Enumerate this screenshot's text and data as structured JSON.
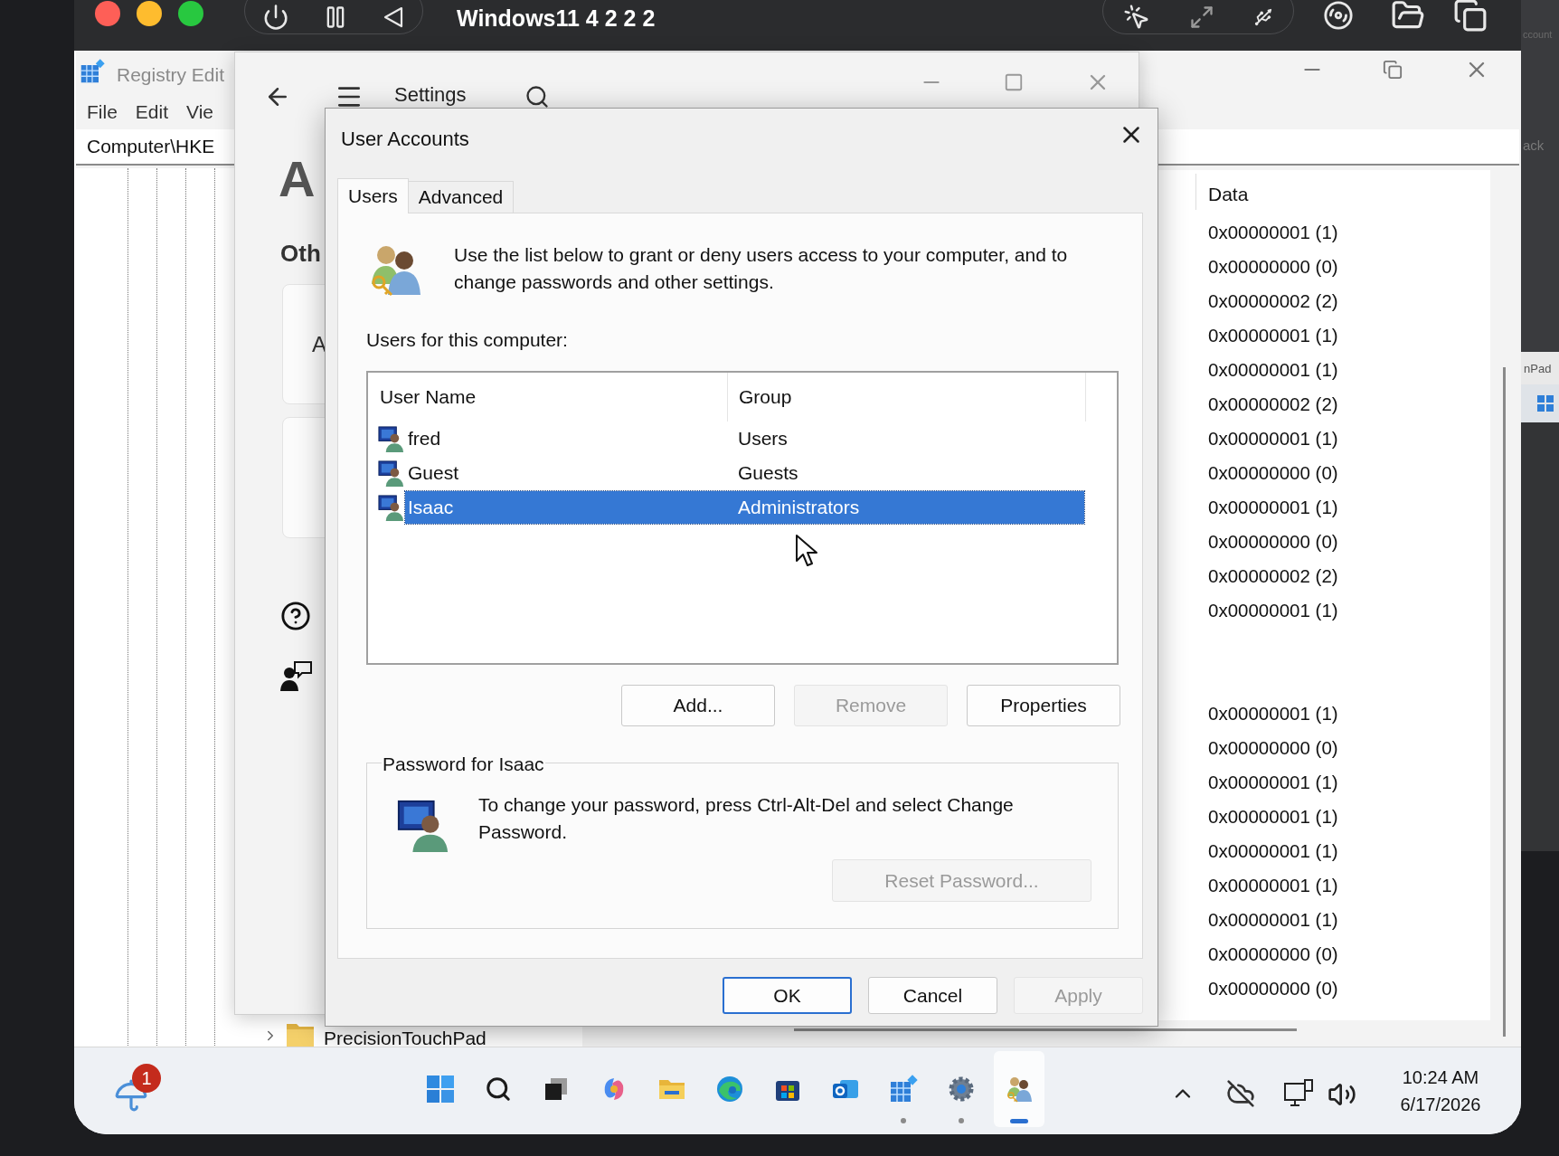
{
  "host_window": {
    "title": "Windows11 4 2 2 2"
  },
  "edge_fragments": {
    "top": "ccount",
    "middle": "ack",
    "tab": "nPad"
  },
  "registry_editor": {
    "title": "Registry Edit",
    "menu": [
      "File",
      "Edit",
      "Vie"
    ],
    "address": "Computer\\HKE",
    "data_header": "Data",
    "data_values_top": [
      "0x00000001 (1)",
      "0x00000000 (0)",
      "0x00000002 (2)",
      "0x00000001 (1)",
      "0x00000001 (1)",
      "0x00000002 (2)",
      "0x00000001 (1)",
      "0x00000000 (0)",
      "0x00000001 (1)",
      "0x00000000 (0)",
      "0x00000002 (2)",
      "0x00000001 (1)"
    ],
    "data_values_bottom": [
      "0x00000001 (1)",
      "0x00000000 (0)",
      "0x00000001 (1)",
      "0x00000001 (1)",
      "0x00000001 (1)",
      "0x00000001 (1)",
      "0x00000001 (1)",
      "0x00000000 (0)",
      "0x00000000 (0)"
    ],
    "tree_item": "PrecisionTouchPad"
  },
  "settings": {
    "title": "Settings",
    "heading": "A",
    "section": "Oth",
    "card_text": "A"
  },
  "user_accounts": {
    "title": "User Accounts",
    "tabs": [
      {
        "label": "Users",
        "selected": true
      },
      {
        "label": "Advanced",
        "selected": false
      }
    ],
    "intro": "Use the list below to grant or deny users access to your computer, and to change passwords and other settings.",
    "list_label": "Users for this computer:",
    "columns": [
      "User Name",
      "Group"
    ],
    "users": [
      {
        "name": "fred",
        "group": "Users",
        "selected": false
      },
      {
        "name": "Guest",
        "group": "Guests",
        "selected": false
      },
      {
        "name": "Isaac",
        "group": "Administrators",
        "selected": true
      }
    ],
    "list_buttons": [
      {
        "label": "Add...",
        "disabled": false
      },
      {
        "label": "Remove",
        "disabled": true
      },
      {
        "label": "Properties",
        "disabled": false
      }
    ],
    "password_group": {
      "title": "Password for Isaac",
      "text": "To change your password, press Ctrl-Alt-Del and select Change Password.",
      "button": {
        "label": "Reset Password...",
        "disabled": true
      }
    },
    "footer_buttons": [
      {
        "label": "OK",
        "disabled": false,
        "default": true
      },
      {
        "label": "Cancel",
        "disabled": false,
        "default": false
      },
      {
        "label": "Apply",
        "disabled": true,
        "default": false
      }
    ]
  },
  "taskbar": {
    "weather_badge": "1",
    "apps": [
      {
        "kind": "start",
        "running": false,
        "selected": false
      },
      {
        "kind": "search",
        "running": false,
        "selected": false
      },
      {
        "kind": "taskview",
        "running": false,
        "selected": false
      },
      {
        "kind": "copilot",
        "running": false,
        "selected": false
      },
      {
        "kind": "explorer",
        "running": false,
        "selected": false
      },
      {
        "kind": "edge",
        "running": false,
        "selected": false
      },
      {
        "kind": "store",
        "running": false,
        "selected": false
      },
      {
        "kind": "outlook",
        "running": false,
        "selected": false
      },
      {
        "kind": "regedit",
        "running": true,
        "selected": false
      },
      {
        "kind": "settings",
        "running": true,
        "selected": false
      },
      {
        "kind": "useraccounts",
        "running": true,
        "selected": true
      }
    ],
    "time": "10:24 AM",
    "date": "6/17/2026"
  }
}
